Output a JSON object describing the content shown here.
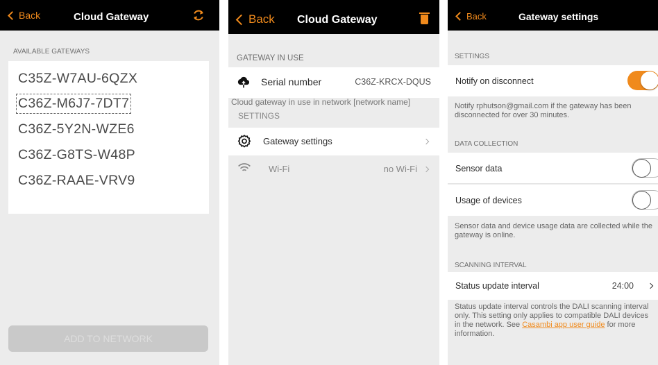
{
  "colors": {
    "accent": "#f08a1c",
    "nav_bg": "#000000",
    "page_bg": "#ececec"
  },
  "panel1": {
    "nav": {
      "back_label": "Back",
      "title": "Cloud Gateway",
      "refresh_icon": "refresh-icon"
    },
    "section": "AVAILABLE GATEWAYS",
    "gateways": [
      {
        "id": "C35Z-W7AU-6QZX",
        "selected": false
      },
      {
        "id": "C36Z-M6J7-7DT7",
        "selected": true
      },
      {
        "id": "C36Z-5Y2N-WZE6",
        "selected": false
      },
      {
        "id": "C36Z-G8TS-W48P",
        "selected": false
      },
      {
        "id": "C36Z-RAAE-VRV9",
        "selected": false
      }
    ],
    "add_button": "ADD TO NETWORK"
  },
  "panel2": {
    "nav": {
      "back_label": "Back",
      "title": "Cloud Gateway",
      "trash_icon": "trash-icon"
    },
    "section_in_use": "GATEWAY IN USE",
    "serial": {
      "label": "Serial number",
      "value": "C36Z-KRCX-DQUS",
      "icon": "cloud-upload-icon"
    },
    "in_use_note": "Cloud gateway in use in network [network name]",
    "section_settings": "SETTINGS",
    "gateway_settings": {
      "label": "Gateway settings",
      "icon": "gear-icon"
    },
    "wifi": {
      "label": "Wi-Fi",
      "value": "no Wi-Fi",
      "icon": "wifi-icon"
    }
  },
  "panel3": {
    "nav": {
      "back_label": "Back",
      "title": "Gateway settings"
    },
    "section_settings": "SETTINGS",
    "notify": {
      "label": "Notify on disconnect",
      "on": true
    },
    "notify_note": "Notify rphutson@gmail.com if the gateway has been disconnected for over 30 minutes.",
    "section_data": "DATA COLLECTION",
    "sensor": {
      "label": "Sensor data",
      "on": false
    },
    "usage": {
      "label": "Usage of devices",
      "on": false
    },
    "data_note": "Sensor data and device usage data are collected while the gateway is online.",
    "section_scan": "SCANNING INTERVAL",
    "status_interval": {
      "label": "Status update interval",
      "value": "24:00"
    },
    "scan_note_a": "Status update interval controls the DALI scanning interval only. This setting only applies to compatible DALI devices in the network. See ",
    "scan_note_link": "Casambi app user guide",
    "scan_note_b": " for more information."
  }
}
